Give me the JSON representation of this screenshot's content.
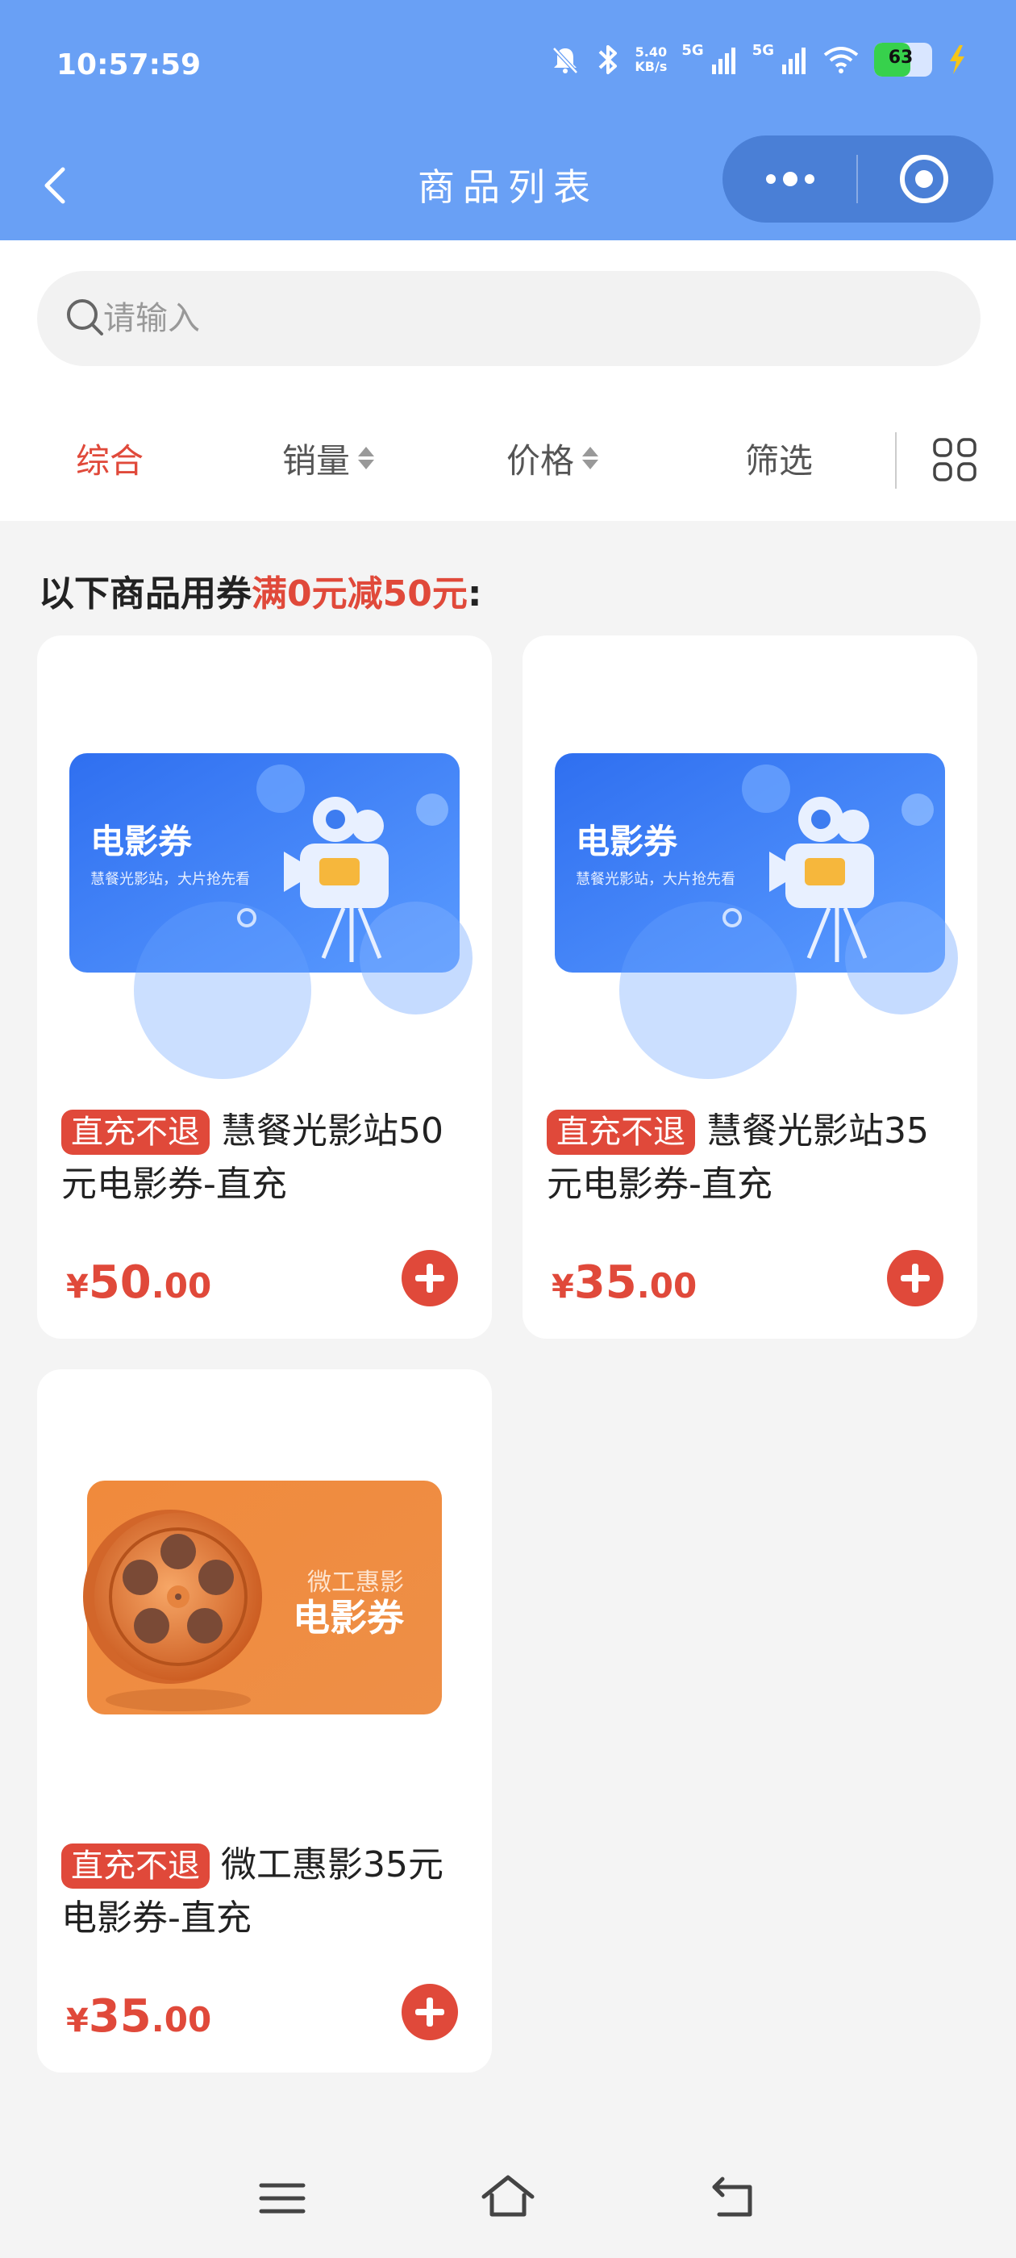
{
  "status_bar": {
    "time": "10:57:59",
    "net_speed_value": "5.40",
    "net_speed_unit": "KB/s",
    "signal1_label": "5G",
    "signal2_label": "5G",
    "battery": "63"
  },
  "nav": {
    "title": "商品列表"
  },
  "search": {
    "placeholder": "请输入"
  },
  "filters": {
    "comprehensive": "综合",
    "sales": "销量",
    "price": "价格",
    "filter": "筛选"
  },
  "coupon_note": {
    "prefix": "以下商品用券",
    "highlight": "满0元减50元",
    "suffix": ":"
  },
  "products": [
    {
      "tag": "直充不退",
      "title": "慧餐光影站50元电影券-直充",
      "currency": "¥",
      "price_int": "50",
      "price_dec": ".00",
      "banner_title": "电影券",
      "banner_sub": "慧餐光影站，大片抢先看"
    },
    {
      "tag": "直充不退",
      "title": "慧餐光影站35元电影券-直充",
      "currency": "¥",
      "price_int": "35",
      "price_dec": ".00",
      "banner_title": "电影券",
      "banner_sub": "慧餐光影站，大片抢先看"
    },
    {
      "tag": "直充不退",
      "title": "微工惠影35元电影券-直充",
      "currency": "¥",
      "price_int": "35",
      "price_dec": ".00",
      "banner_brand": "微工惠影",
      "banner_title": "电影券"
    }
  ],
  "colors": {
    "header": "#69a0f5",
    "accent": "#e0493a",
    "capsule": "#4a7fd6"
  }
}
